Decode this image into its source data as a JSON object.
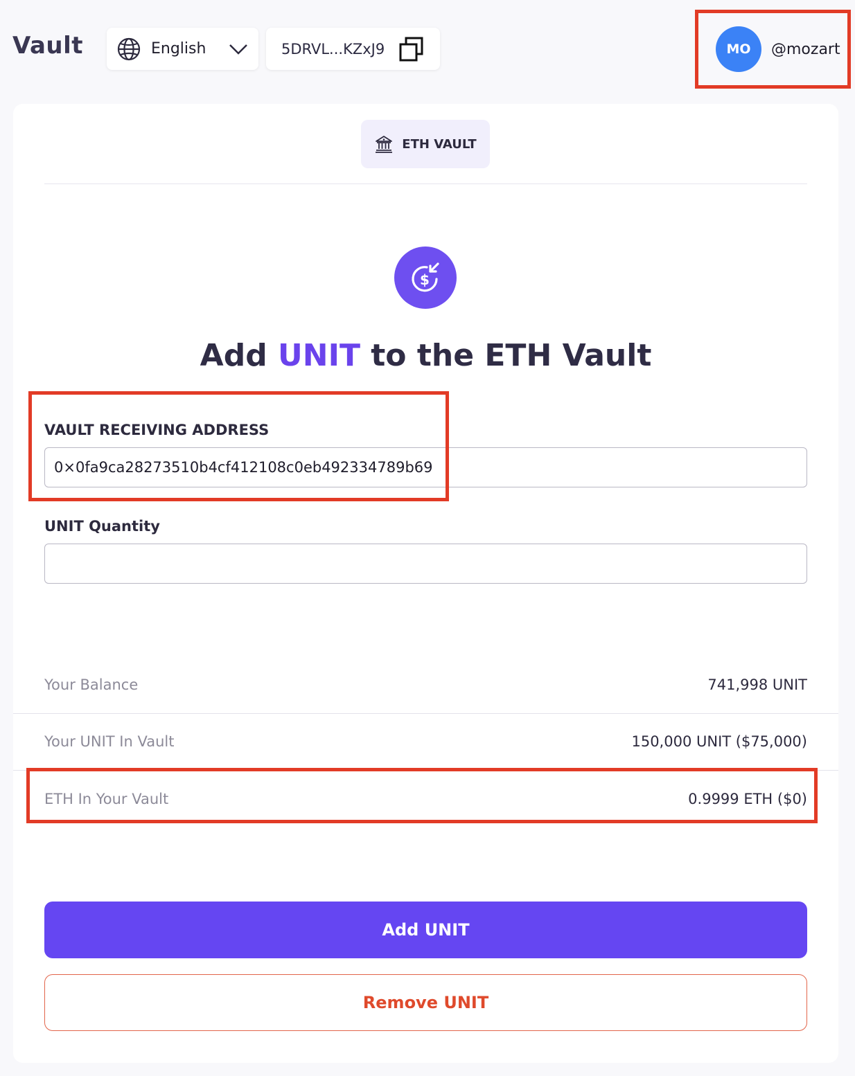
{
  "header": {
    "app_title": "Vault",
    "language": {
      "icon": "globe-icon",
      "label": "English",
      "chevron": "chevron-down-icon"
    },
    "wallet": {
      "address_short": "5DRVL...KZxJ9",
      "copy_icon": "copy-icon"
    },
    "user": {
      "initials": "MO",
      "handle": "@mozart",
      "avatar_color": "#3b82f6"
    }
  },
  "card": {
    "tab": {
      "icon": "bank-icon",
      "label": "ETH VAULT"
    },
    "hero": {
      "icon": "deposit-dollar-icon",
      "title_prefix": "Add ",
      "title_accent": "UNIT",
      "title_suffix": " to the ETH Vault"
    },
    "form": {
      "address_label": "VAULT RECEIVING ADDRESS",
      "address_value": "0×0fa9ca28273510b4cf412108c0eb492334789b69",
      "quantity_label": "UNIT Quantity",
      "quantity_value": ""
    },
    "info_rows": [
      {
        "label": "Your Balance",
        "value": "741,998 UNIT"
      },
      {
        "label": "Your UNIT In Vault",
        "value": "150,000 UNIT ($75,000)"
      },
      {
        "label": "ETH In Your Vault",
        "value": "0.9999 ETH ($0)"
      }
    ],
    "buttons": {
      "add_label": "Add UNIT",
      "remove_label": "Remove UNIT"
    }
  },
  "colors": {
    "accent": "#6546f2",
    "danger": "#df4a2c",
    "highlight": "#e23b26"
  }
}
